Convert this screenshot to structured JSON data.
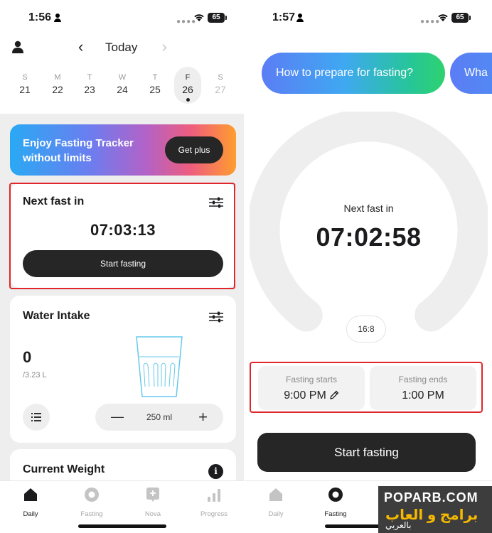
{
  "left": {
    "status": {
      "time": "1:56",
      "battery": "65"
    },
    "nav": {
      "title": "Today",
      "prev": "‹",
      "next": "›"
    },
    "week": [
      {
        "letter": "S",
        "num": "21"
      },
      {
        "letter": "M",
        "num": "22"
      },
      {
        "letter": "T",
        "num": "23"
      },
      {
        "letter": "W",
        "num": "24"
      },
      {
        "letter": "T",
        "num": "25"
      },
      {
        "letter": "F",
        "num": "26"
      },
      {
        "letter": "S",
        "num": "27"
      }
    ],
    "promo": {
      "text": "Enjoy Fasting Tracker without limits",
      "button": "Get plus"
    },
    "next_fast": {
      "title": "Next fast in",
      "time": "07:03:13",
      "button": "Start fasting"
    },
    "water": {
      "title": "Water Intake",
      "value": "0",
      "goal": "/3.23 L",
      "minus": "—",
      "amount": "250 ml",
      "plus": "+"
    },
    "weight": {
      "title": "Current Weight",
      "info": "i"
    }
  },
  "right": {
    "status": {
      "time": "1:57",
      "battery": "65"
    },
    "chips": [
      "How to prepare for fasting?",
      "Wha"
    ],
    "next_fast": {
      "label": "Next fast in",
      "time": "07:02:58",
      "plan": "16:8"
    },
    "fasting_starts": {
      "label": "Fasting starts",
      "value": "9:00 PM"
    },
    "fasting_ends": {
      "label": "Fasting ends",
      "value": "1:00 PM"
    },
    "button": "Start fasting"
  },
  "tabs": [
    {
      "label": "Daily",
      "icon": "home-icon"
    },
    {
      "label": "Fasting",
      "icon": "fasting-icon"
    },
    {
      "label": "Nova",
      "icon": "nova-icon"
    },
    {
      "label": "Progress",
      "icon": "progress-icon"
    }
  ],
  "watermark": {
    "site": "POPARB.COM",
    "line1": "برامج و العاب",
    "line2": "بالعربي"
  },
  "colors": {
    "accent_dark": "#262626",
    "highlight_red": "#e0252b",
    "ring": "#eeeeee"
  }
}
